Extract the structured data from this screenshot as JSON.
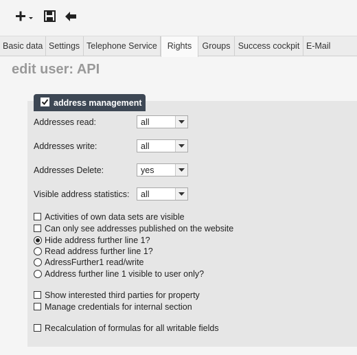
{
  "toolbar": {
    "add_icon": "plus-dropdown-icon",
    "save_icon": "floppy-disk-icon",
    "back_icon": "arrow-left-icon"
  },
  "tabs": [
    {
      "label": "Basic data",
      "active": false
    },
    {
      "label": "Settings",
      "active": false
    },
    {
      "label": "Telephone Service",
      "active": false
    },
    {
      "label": "Rights",
      "active": true
    },
    {
      "label": "Groups",
      "active": false
    },
    {
      "label": "Success cockpit",
      "active": false
    },
    {
      "label": "E-Mail",
      "active": false
    }
  ],
  "page": {
    "title": "edit user: API"
  },
  "section": {
    "label": "address management",
    "checked": true
  },
  "fields": [
    {
      "label": "Addresses read:",
      "value": "all"
    },
    {
      "label": "Addresses write:",
      "value": "all"
    },
    {
      "label": "Addresses Delete:",
      "value": "yes"
    },
    {
      "label": "Visible address statistics:",
      "value": "all"
    }
  ],
  "options": [
    {
      "type": "checkbox",
      "label": "Activities of own data sets are visible",
      "checked": false
    },
    {
      "type": "checkbox",
      "label": "Can only see addresses published on the website",
      "checked": false
    },
    {
      "type": "radio",
      "label": "Hide address further line 1?",
      "checked": true
    },
    {
      "type": "radio",
      "label": "Read address further line 1?",
      "checked": false
    },
    {
      "type": "radio",
      "label": "AdressFurther1 read/write",
      "checked": false
    },
    {
      "type": "radio",
      "label": "Address further line 1 visible to user only?",
      "checked": false
    },
    {
      "type": "checkbox",
      "label": "Show interested third parties for property",
      "checked": false
    },
    {
      "type": "checkbox",
      "label": "Manage credentials for internal section",
      "checked": false
    },
    {
      "type": "checkbox",
      "label": "Recalculation of formulas for all writable fields",
      "checked": false
    }
  ],
  "colors": {
    "section_header": "#3d4754",
    "panel": "#e6e6e6",
    "title": "#999999"
  }
}
